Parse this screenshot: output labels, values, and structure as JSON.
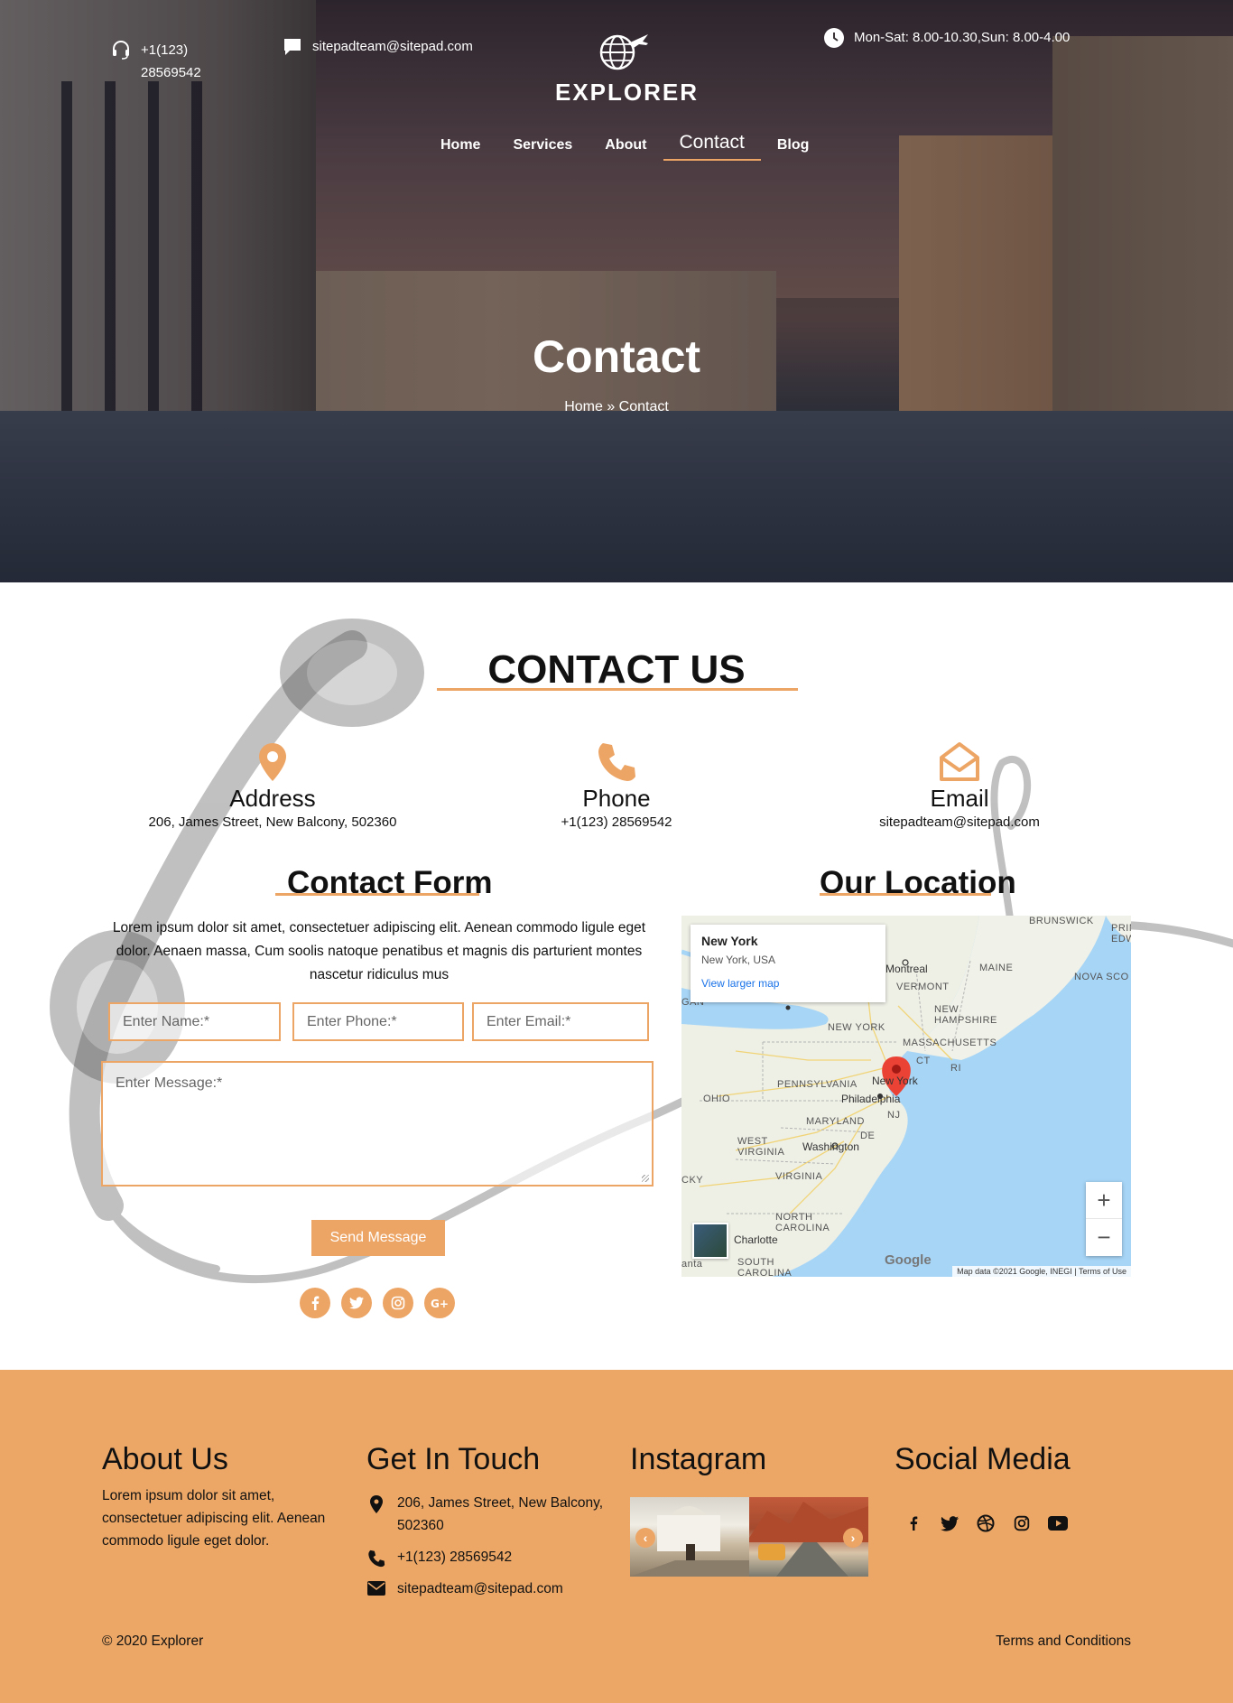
{
  "topbar": {
    "phone": "+1(123) 28569542",
    "email": "sitepadteam@sitepad.com",
    "hours": "Mon-Sat: 8.00-10.30,Sun: 8.00-4.00"
  },
  "logo": {
    "text": "EXPLORER"
  },
  "nav": {
    "items": [
      {
        "label": "Home"
      },
      {
        "label": "Services"
      },
      {
        "label": "About"
      },
      {
        "label": "Contact",
        "active": true
      },
      {
        "label": "Blog"
      }
    ]
  },
  "hero": {
    "title": "Contact",
    "breadcrumb": "Home » Contact"
  },
  "contact": {
    "title": "CONTACT US",
    "address": {
      "label": "Address",
      "value": "206, James Street, New Balcony, 502360"
    },
    "phone": {
      "label": "Phone",
      "value": "+1(123) 28569542"
    },
    "email": {
      "label": "Email",
      "value": "sitepadteam@sitepad.com"
    }
  },
  "form": {
    "title": "Contact Form",
    "description": "Lorem ipsum dolor sit amet, consectetuer adipiscing elit. Aenean commodo ligule eget dolor. Aenaen massa, Cum soolis natoque penatibus et magnis dis parturient montes nascetur ridiculus mus",
    "name_placeholder": "Enter Name:*",
    "phone_placeholder": "Enter Phone:*",
    "email_placeholder": "Enter Email:*",
    "message_placeholder": "Enter Message:*",
    "send_label": "Send Message",
    "social": [
      "facebook-icon",
      "twitter-icon",
      "instagram-icon",
      "google-plus-icon"
    ]
  },
  "location": {
    "title": "Our Location",
    "card_title": "New York",
    "card_subtitle": "New York, USA",
    "card_link": "View larger map",
    "labels": {
      "montreal": "Montreal",
      "maine": "MAINE",
      "vermont": "VERMONT",
      "new_hampshire": "NEW\nHAMPSHIRE",
      "nova_scotia": "NOVA SCO",
      "brunswick": "BRUNSWICK",
      "prince": "PRIN\nEDW",
      "new_york_state": "NEW YORK",
      "massachusetts": "MASSACHUSETTS",
      "ct": "CT",
      "ri": "RI",
      "pennsylvania": "PENNSYLVANIA",
      "new_york_city": "New York",
      "philadelphia": "Philadelphia",
      "nj": "NJ",
      "ohio": "OHIO",
      "maryland": "MARYLAND",
      "de": "DE",
      "west_virginia": "WEST\nVIRGINIA",
      "washington": "Washington",
      "virginia": "VIRGINIA",
      "north_carolina": "NORTH\nCAROLINA",
      "charlotte": "Charlotte",
      "south_carolina": "SOUTH\nCAROLINA",
      "gan": "GAN",
      "cky": "CKY",
      "anta": "anta"
    },
    "zoom_in": "+",
    "zoom_out": "−",
    "google": "Google",
    "attribution": "Map data ©2021 Google, INEGI | Terms of Use"
  },
  "footer": {
    "about_title": "About Us",
    "about_text": "Lorem ipsum dolor sit amet, consectetuer adipiscing elit. Aenean commodo ligule eget dolor.",
    "touch_title": "Get In Touch",
    "touch_address": "206, James Street, New Balcony, 502360",
    "touch_phone": "+1(123) 28569542",
    "touch_email": "sitepadteam@sitepad.com",
    "instagram_title": "Instagram",
    "social_title": "Social Media",
    "social": [
      "facebook-icon",
      "twitter-icon",
      "dribbble-icon",
      "instagram-icon",
      "youtube-icon"
    ],
    "copyright": "© 2020 Explorer",
    "terms": "Terms and Conditions"
  },
  "colors": {
    "accent": "#eda565",
    "footer_bg": "#eca766",
    "map_water": "#a7d5f6",
    "map_pin": "#ea4335"
  }
}
